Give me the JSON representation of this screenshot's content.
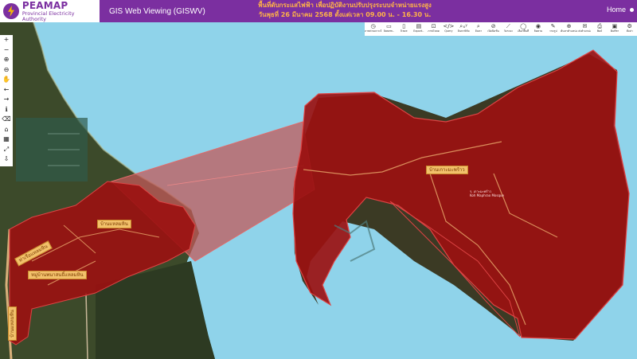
{
  "header": {
    "logo_title": "PEAMAP",
    "logo_subtitle": "Provincial Electricity Authority",
    "app_title": "GIS Web Viewing (GISWV)",
    "announcement_line1": "พื้นที่ดับกระแสไฟฟ้า เพื่อปฏิบัติงานปรับปรุงระบบจำหน่ายแรงสูง",
    "announcement_line2": "วันพุธที่ 26 มีนาคม 2568 ตั้งแต่เวลา 09.00 น. - 16.30 น.",
    "home_label": "Home"
  },
  "toolbar": {
    "tools": [
      {
        "glyph": "◷",
        "label": "ภาพถ่ายดาวเทียม",
        "icon": "history-icon"
      },
      {
        "glyph": "▭",
        "label": "Basem..",
        "icon": "basemap-icon"
      },
      {
        "glyph": "▯",
        "label": "Trace",
        "icon": "trace-icon"
      },
      {
        "glyph": "▤",
        "label": "Export..",
        "icon": "export-icon"
      },
      {
        "glyph": "⊡",
        "label": "ภาพโหลด",
        "icon": "layer-icon"
      },
      {
        "glyph": "</>",
        "label": "Query",
        "icon": "query-icon"
      },
      {
        "glyph": "⌕ₓʸ",
        "label": "ค้นหาพิกัด",
        "icon": "search-xy-icon"
      },
      {
        "glyph": "⌕",
        "label": "ค้นหา",
        "icon": "search-icon"
      },
      {
        "glyph": "⊘",
        "label": "เปิดปิดชั้น",
        "icon": "toggle-layer-icon"
      },
      {
        "glyph": "⟋",
        "label": "วัดระยะ",
        "icon": "measure-icon"
      },
      {
        "glyph": "◯",
        "label": "เลือกพื้นที่",
        "icon": "select-area-icon"
      },
      {
        "glyph": "◉",
        "label": "ติดตาม",
        "icon": "track-icon"
      },
      {
        "glyph": "✎",
        "label": "วาดรูป",
        "icon": "draw-icon"
      },
      {
        "glyph": "⊕",
        "label": "ค้นหาตำแหน่ง",
        "icon": "locate-icon"
      },
      {
        "glyph": "✉",
        "label": "ส่งตำแหน่ง",
        "icon": "share-icon"
      },
      {
        "glyph": "⎙",
        "label": "พิมพ์",
        "icon": "print-icon"
      },
      {
        "glyph": "▣",
        "label": "Buffer",
        "icon": "buffer-icon"
      },
      {
        "glyph": "⚙",
        "label": "ตั้งค่า",
        "icon": "settings-icon"
      }
    ]
  },
  "left_tools": [
    {
      "glyph": "+",
      "icon": "zoom-in-icon"
    },
    {
      "glyph": "−",
      "icon": "zoom-out-icon"
    },
    {
      "glyph": "⊕",
      "icon": "zoom-box-in-icon"
    },
    {
      "glyph": "⊖",
      "icon": "zoom-box-out-icon"
    },
    {
      "glyph": "✋",
      "icon": "pan-icon"
    },
    {
      "glyph": "←",
      "icon": "previous-extent-icon"
    },
    {
      "glyph": "→",
      "icon": "next-extent-icon"
    },
    {
      "glyph": "ℹ",
      "icon": "identify-icon"
    },
    {
      "glyph": "⌫",
      "icon": "erase-icon"
    },
    {
      "glyph": "⌂",
      "icon": "home-extent-icon"
    },
    {
      "glyph": "▦",
      "icon": "map-icon"
    },
    {
      "glyph": "⤢",
      "icon": "fullscreen-icon"
    },
    {
      "glyph": "⇩",
      "icon": "download-icon"
    }
  ],
  "map_labels": {
    "village_east": "บ้านเกาะมะพร้าว",
    "village_center": "บ้านแหลมหิน",
    "village_left": "ท่าเรือแหลมหิน",
    "village_south": "หมู่บ้านพนาสนธิ์แหลมหิน",
    "village_vertical": "บ้านแหลมหิน",
    "small_label_1": "ร. เกาะมะพร้าว",
    "small_label_2": "Koh Maphrao Mosque"
  },
  "colors": {
    "header_purple": "#7b2fa0",
    "outage_fill": "#9b1111",
    "sea": "#8fd3ea",
    "label_bg": "#f2c16b"
  }
}
